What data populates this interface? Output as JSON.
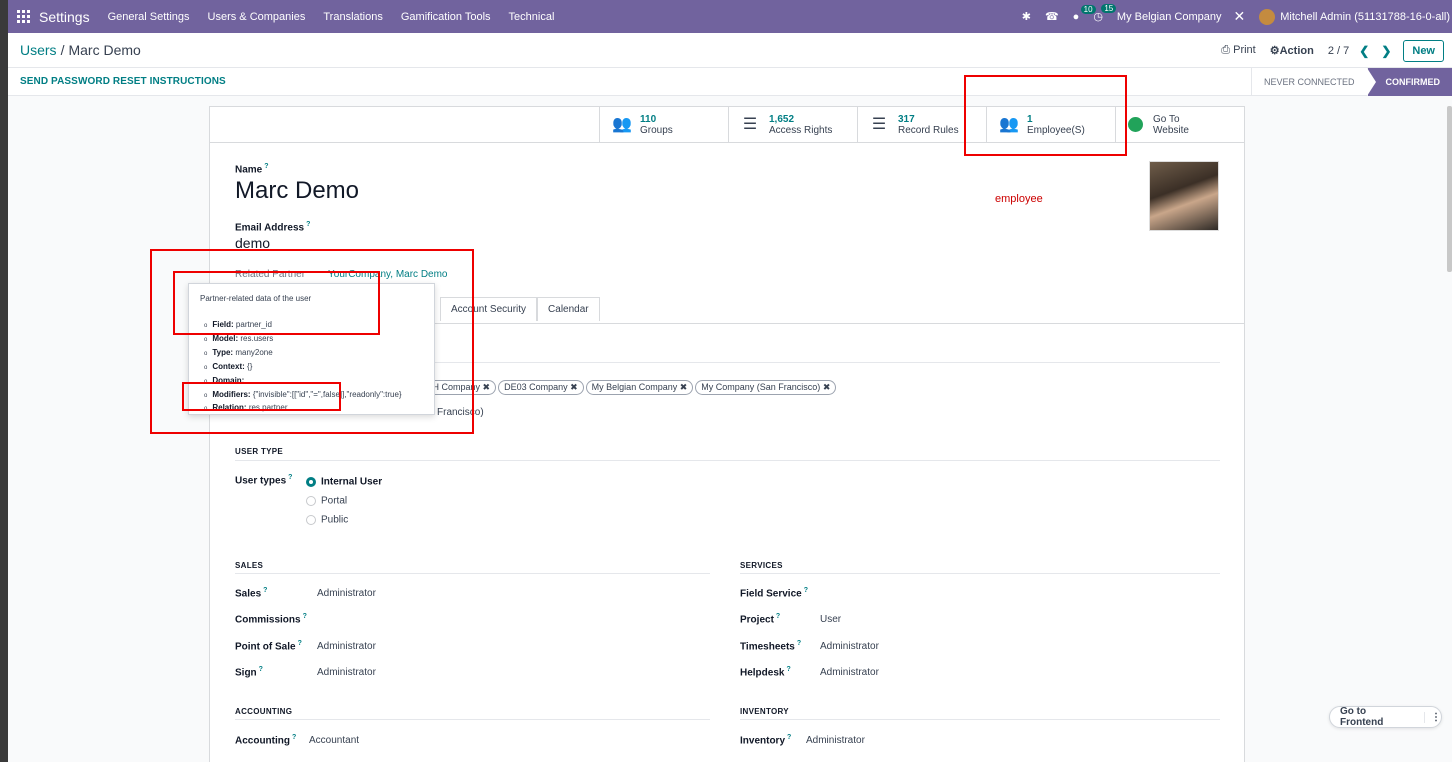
{
  "navbar": {
    "brand": "Settings",
    "menu": [
      "General Settings",
      "Users & Companies",
      "Translations",
      "Gamification Tools",
      "Technical"
    ],
    "messages_count": "10",
    "activities_count": "15",
    "company": "My Belgian Company",
    "user": "Mitchell Admin (51131788-16-0-all)"
  },
  "control": {
    "breadcrumb_parent": "Users",
    "breadcrumb_sep": "/",
    "breadcrumb_current": "Marc Demo",
    "print": "Print",
    "action": "Action",
    "pager": "2 / 7",
    "new": "New"
  },
  "statusbar": {
    "reset": "SEND PASSWORD RESET INSTRUCTIONS",
    "stages": [
      "NEVER CONNECTED",
      "CONFIRMED"
    ]
  },
  "smart_buttons": [
    {
      "value": "110",
      "label": "Groups",
      "icon": "users-icon"
    },
    {
      "value": "1,652",
      "label": "Access Rights",
      "icon": "list-icon"
    },
    {
      "value": "317",
      "label": "Record Rules",
      "icon": "list-icon"
    },
    {
      "value": "1",
      "label": "Employee(S)",
      "icon": "users-icon"
    },
    {
      "value": "Go To",
      "label": "Website",
      "icon": "globe-icon"
    }
  ],
  "form": {
    "name_label": "Name",
    "name_value": "Marc Demo",
    "email_label": "Email Address",
    "email_value": "demo",
    "partner_label": "Related Partner",
    "partner_value": "YourCompany, Marc Demo",
    "annotation": "employee",
    "tabs": [
      "Account Security",
      "Calendar"
    ],
    "company_chips": [
      "CH Company",
      "DE03 Company",
      "My Belgian Company",
      "My Company (San Francisco)"
    ],
    "default_company_tail": "Francisco)"
  },
  "tooltip": {
    "title": "Partner-related data of the user",
    "items": [
      {
        "k": "Field:",
        "v": "partner_id"
      },
      {
        "k": "Model:",
        "v": "res.users"
      },
      {
        "k": "Type:",
        "v": "many2one"
      },
      {
        "k": "Context:",
        "v": "{}"
      },
      {
        "k": "Domain:",
        "v": ""
      },
      {
        "k": "Modifiers:",
        "v": "{\"invisible\":[[\"id\",\"=\",false]],\"readonly\":true}"
      },
      {
        "k": "Relation:",
        "v": "res.partner"
      }
    ]
  },
  "user_type": {
    "section": "USER TYPE",
    "label": "User types",
    "options": [
      "Internal User",
      "Portal",
      "Public"
    ],
    "selected": "Internal User"
  },
  "sales": {
    "section": "SALES",
    "rows": [
      {
        "label": "Sales",
        "value": "Administrator"
      },
      {
        "label": "Commissions",
        "value": ""
      },
      {
        "label": "Point of Sale",
        "value": "Administrator"
      },
      {
        "label": "Sign",
        "value": "Administrator"
      }
    ]
  },
  "services": {
    "section": "SERVICES",
    "rows": [
      {
        "label": "Field Service",
        "value": ""
      },
      {
        "label": "Project",
        "value": "User"
      },
      {
        "label": "Timesheets",
        "value": "Administrator"
      },
      {
        "label": "Helpdesk",
        "value": "Administrator"
      }
    ]
  },
  "accounting": {
    "section": "ACCOUNTING",
    "label": "Accounting",
    "value": "Accountant"
  },
  "inventory": {
    "section": "INVENTORY",
    "label": "Inventory",
    "value": "Administrator"
  },
  "frontend": "Go to Frontend",
  "colors": {
    "navbar": "#71639e",
    "accent": "#017e84",
    "annotation": "#e00000"
  }
}
